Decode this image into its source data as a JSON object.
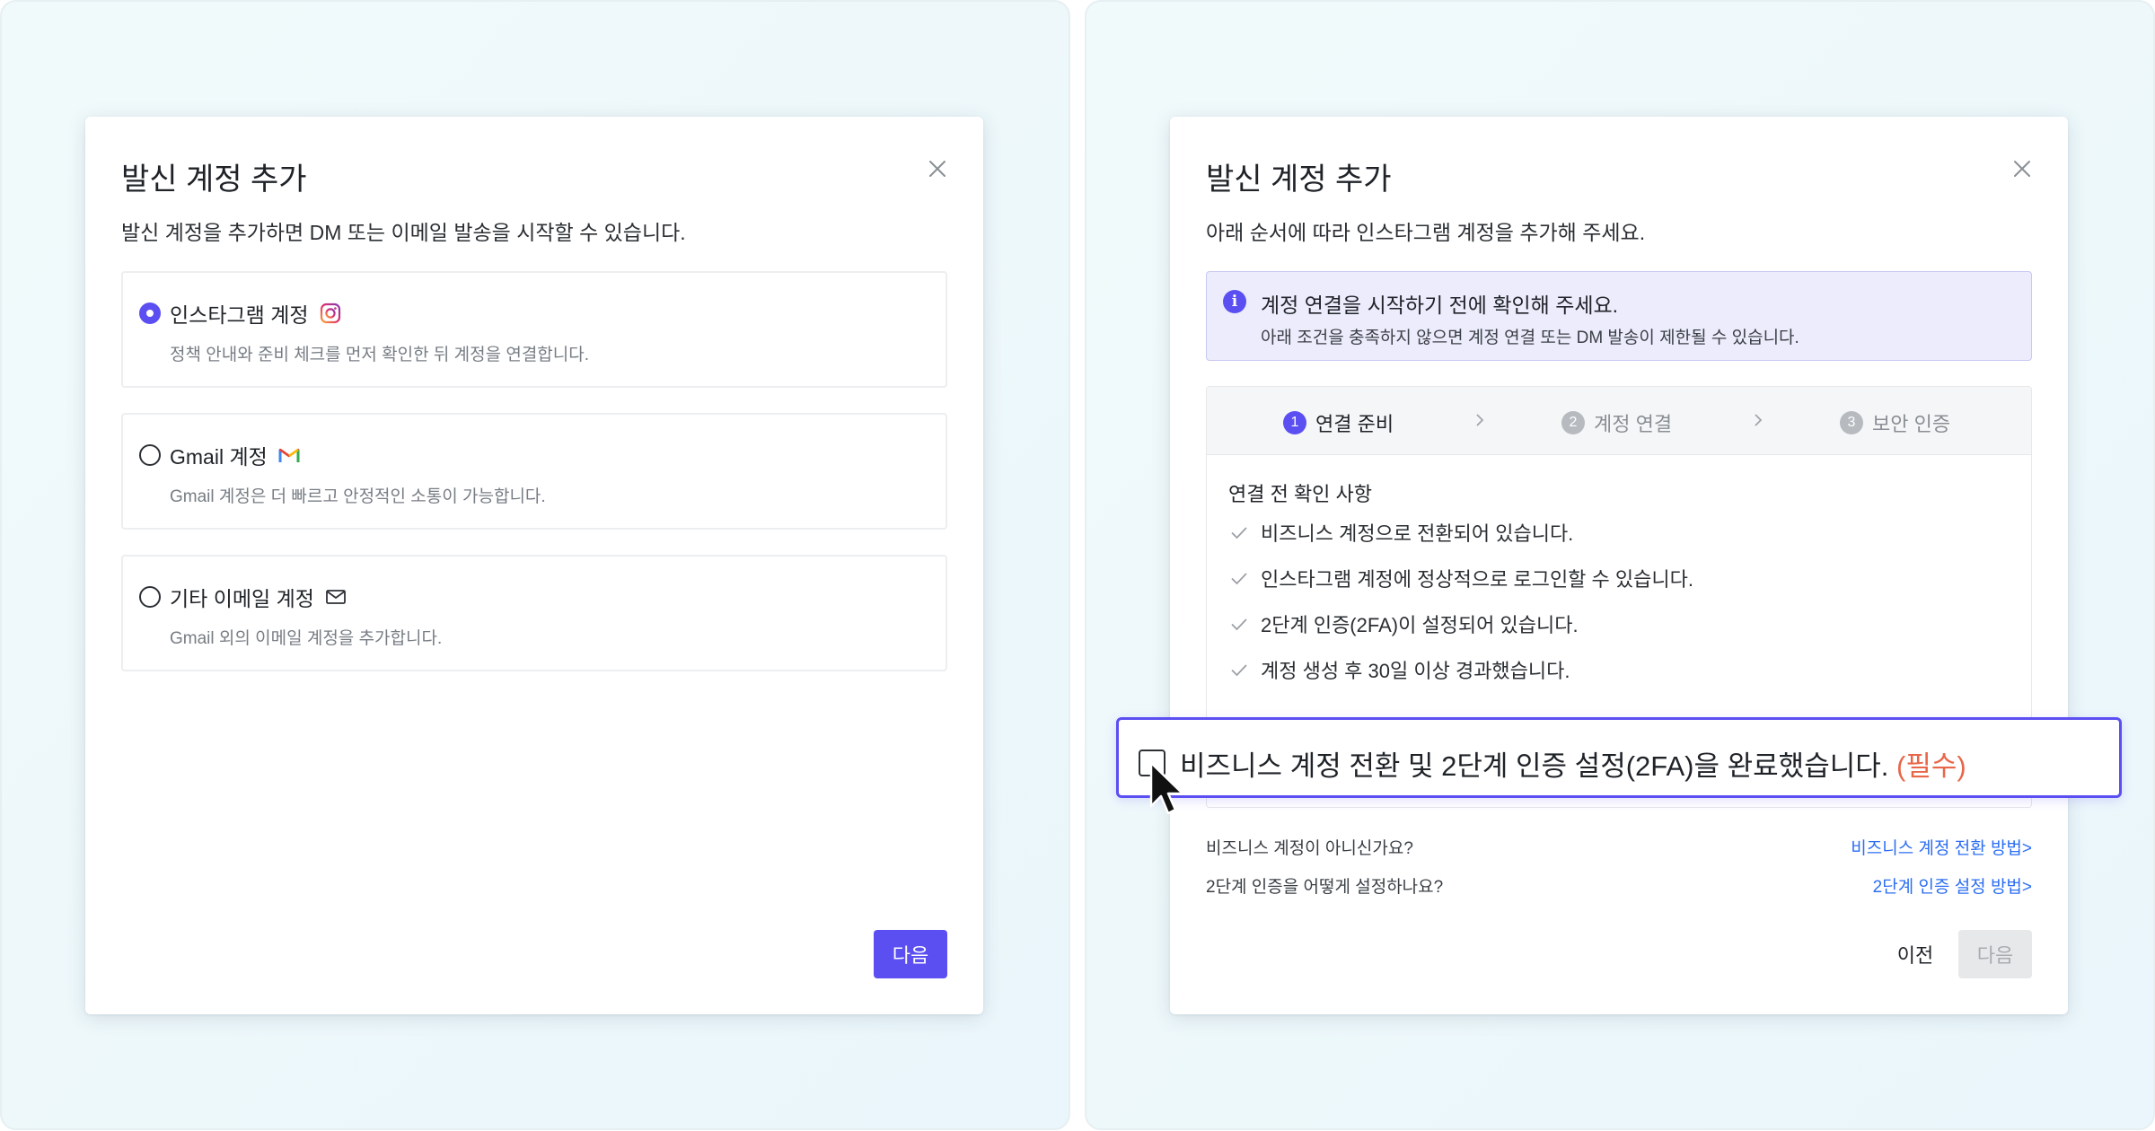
{
  "left": {
    "title": "발신 계정 추가",
    "description": "발신 계정을 추가하면 DM 또는 이메일 발송을 시작할 수 있습니다.",
    "options": [
      {
        "label": "인스타그램 계정",
        "sub": "정책 안내와 준비 체크를 먼저 확인한 뒤 계정을 연결합니다.",
        "icon": "instagram-icon",
        "selected": true
      },
      {
        "label": "Gmail 계정",
        "sub": "Gmail 계정은 더 빠르고 안정적인 소통이 가능합니다.",
        "icon": "gmail-icon",
        "selected": false
      },
      {
        "label": "기타 이메일 계정",
        "sub": "Gmail 외의 이메일 계정을 추가합니다.",
        "icon": "mail-icon",
        "selected": false
      }
    ],
    "next_label": "다음"
  },
  "right": {
    "title": "발신 계정 추가",
    "description": "아래 순서에 따라 인스타그램 계정을 추가해 주세요.",
    "info": {
      "title": "계정 연결을 시작하기 전에 확인해 주세요.",
      "text": "아래 조건을 충족하지 않으면 계정 연결 또는 DM 발송이 제한될 수 있습니다."
    },
    "steps": [
      {
        "num": "1",
        "label": "연결 준비",
        "active": true
      },
      {
        "num": "2",
        "label": "계정 연결",
        "active": false
      },
      {
        "num": "3",
        "label": "보안 인증",
        "active": false
      }
    ],
    "checklist_title": "연결 전 확인 사항",
    "checklist": [
      "비즈니스 계정으로 전환되어 있습니다.",
      "인스타그램 계정에 정상적으로 로그인할 수 있습니다.",
      "2단계 인증(2FA)이 설정되어 있습니다.",
      "계정 생성 후 30일 이상 경과했습니다."
    ],
    "confirm": {
      "text": "비즈니스 계정 전환 및 2단계 인증 설정(2FA)을 완료했습니다.",
      "required": "(필수)",
      "checked": false
    },
    "help": [
      {
        "question": "비즈니스 계정이 아니신가요?",
        "link": "비즈니스 계정 전환 방법>"
      },
      {
        "question": "2단계 인증을 어떻게 설정하나요?",
        "link": "2단계 인증 설정 방법>"
      }
    ],
    "prev_label": "이전",
    "next_label": "다음"
  },
  "colors": {
    "accent": "#5b4ff2",
    "link": "#2c6ef2",
    "required": "#e8674a"
  }
}
